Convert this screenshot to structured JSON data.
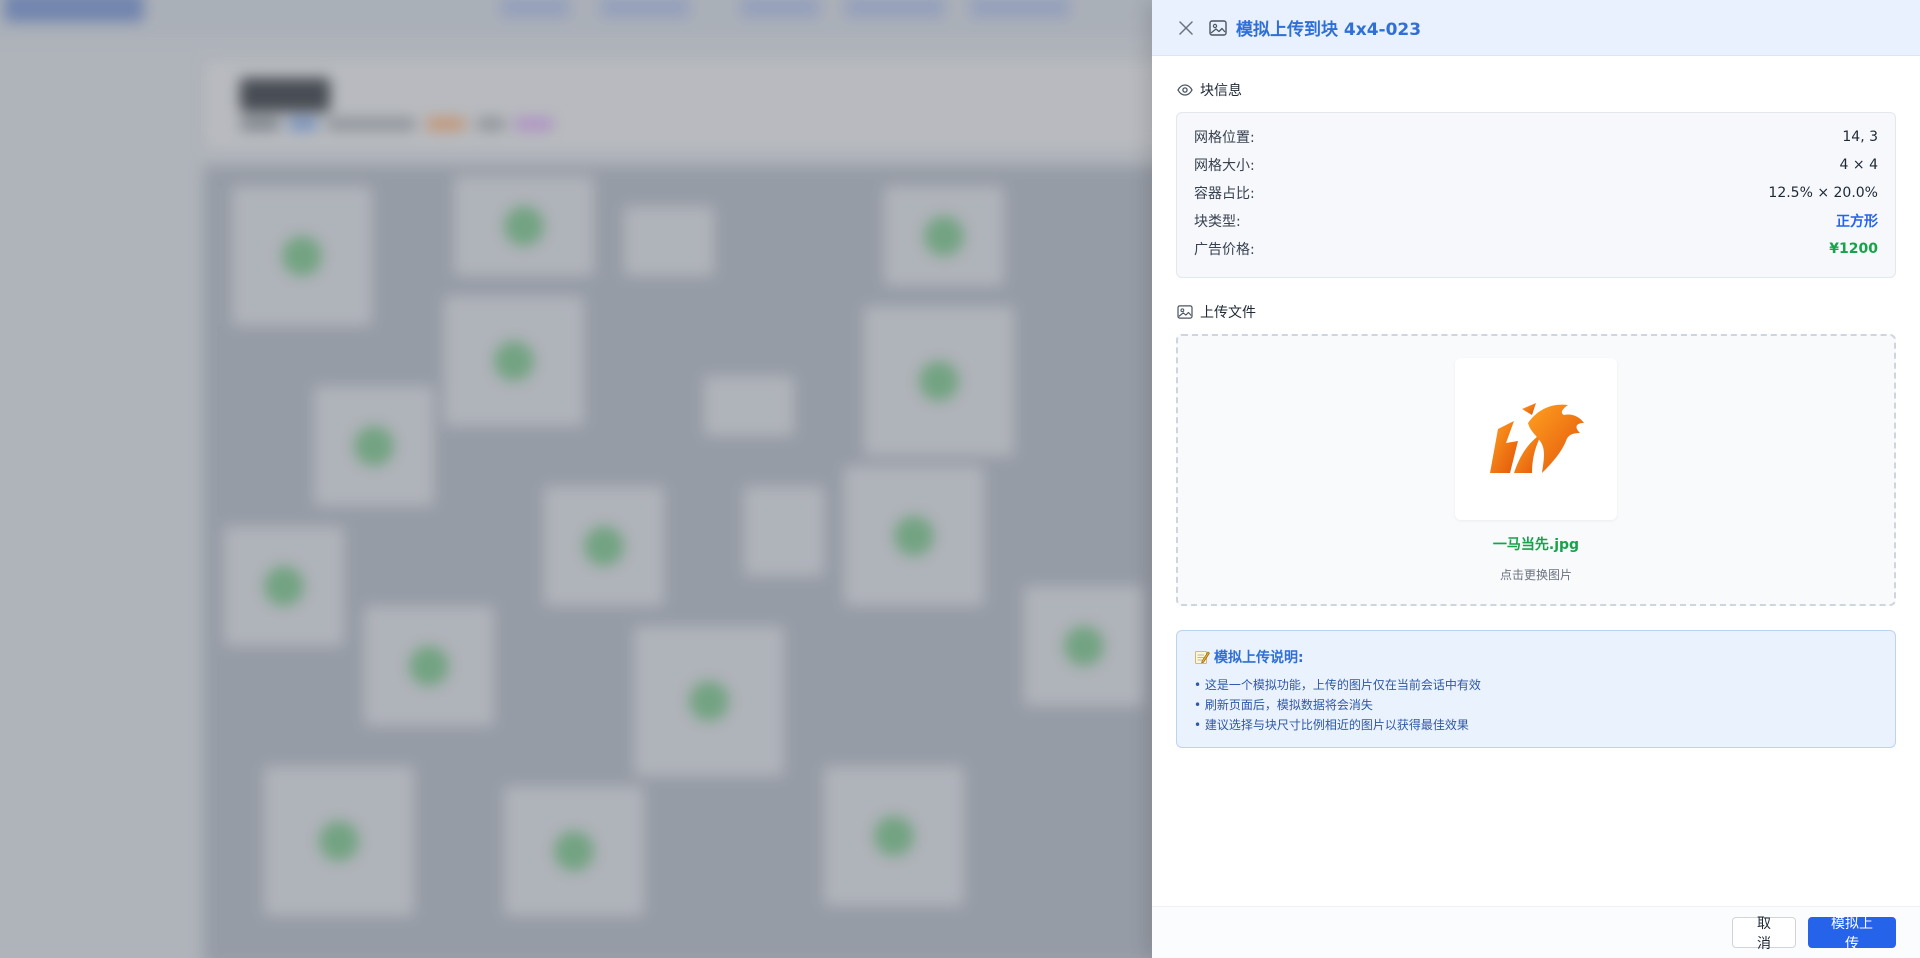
{
  "drawer": {
    "title": "模拟上传到块 4x4-023",
    "close_icon": "close-icon",
    "title_icon": "image-icon"
  },
  "block_info": {
    "section_label": "块信息",
    "section_icon": "eye-icon",
    "rows": [
      {
        "key": "网格位置:",
        "value": "14, 3"
      },
      {
        "key": "网格大小:",
        "value": "4 × 4"
      },
      {
        "key": "容器占比:",
        "value": "12.5% × 20.0%"
      },
      {
        "key": "块类型:",
        "value": "正方形"
      },
      {
        "key": "广告价格:",
        "value": "¥1200"
      }
    ]
  },
  "upload": {
    "section_label": "上传文件",
    "section_icon": "image-icon",
    "file_name": "一马当先.jpg",
    "hint": "点击更换图片"
  },
  "note": {
    "title": "模拟上传说明:",
    "icon": "memo-icon",
    "items": [
      "• 这是一个模拟功能，上传的图片仅在当前会话中有效",
      "• 刷新页面后，模拟数据将会消失",
      "• 建议选择与块尺寸比例相近的图片以获得最佳效果"
    ]
  },
  "footer": {
    "cancel_label": "取 消",
    "submit_label": "模拟上传"
  },
  "colors": {
    "accent": "#2563eb",
    "header_bg": "#e8f1fd",
    "price_green": "#16a34a",
    "logo_orange": "#f07a10"
  }
}
